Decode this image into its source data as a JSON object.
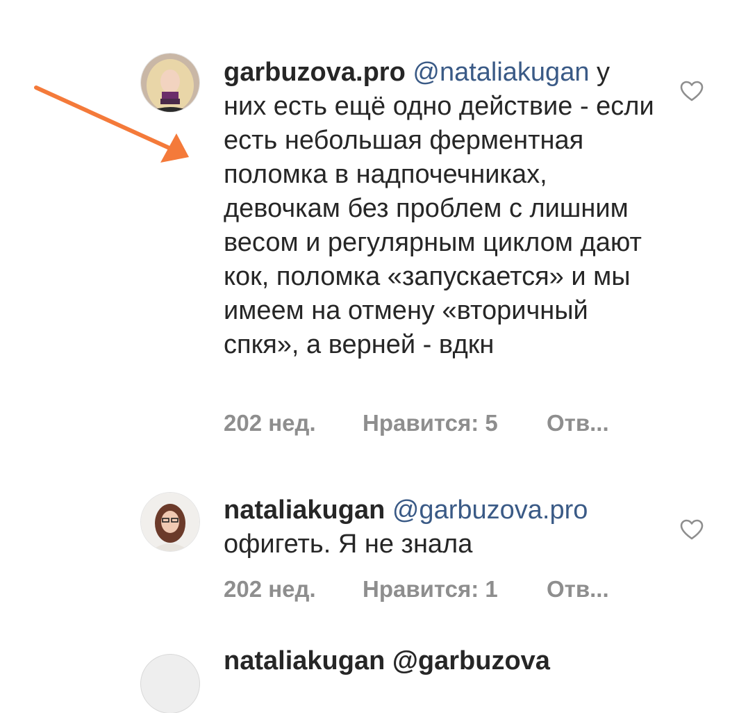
{
  "comments": [
    {
      "username": "garbuzova.pro",
      "mention": "@nataliakugan",
      "text": "у них есть ещё одно действие - если есть небольшая ферментная поломка в надпочечниках, девочкам без проблем с лишним весом и регулярным циклом дают кок, поломка «запускается» и мы имеем на отмену «вторичный спкя», а верней - вдкн",
      "time": "202 нед.",
      "likes": "Нравится: 5",
      "reply": "Отв..."
    },
    {
      "username": "nataliakugan",
      "mention": "@garbuzova.pro",
      "text": "офигеть. Я не знала",
      "time": "202 нед.",
      "likes": "Нравится: 1",
      "reply": "Отв..."
    }
  ],
  "next_comment": {
    "partial_text": "nataliakugan @garbuzova"
  },
  "icons": {
    "like": "heart-outline-icon",
    "annotation": "orange-arrow"
  },
  "colors": {
    "text": "#262626",
    "mention": "#3a5a86",
    "meta": "#8e8e8e",
    "arrow": "#f47a3a"
  }
}
